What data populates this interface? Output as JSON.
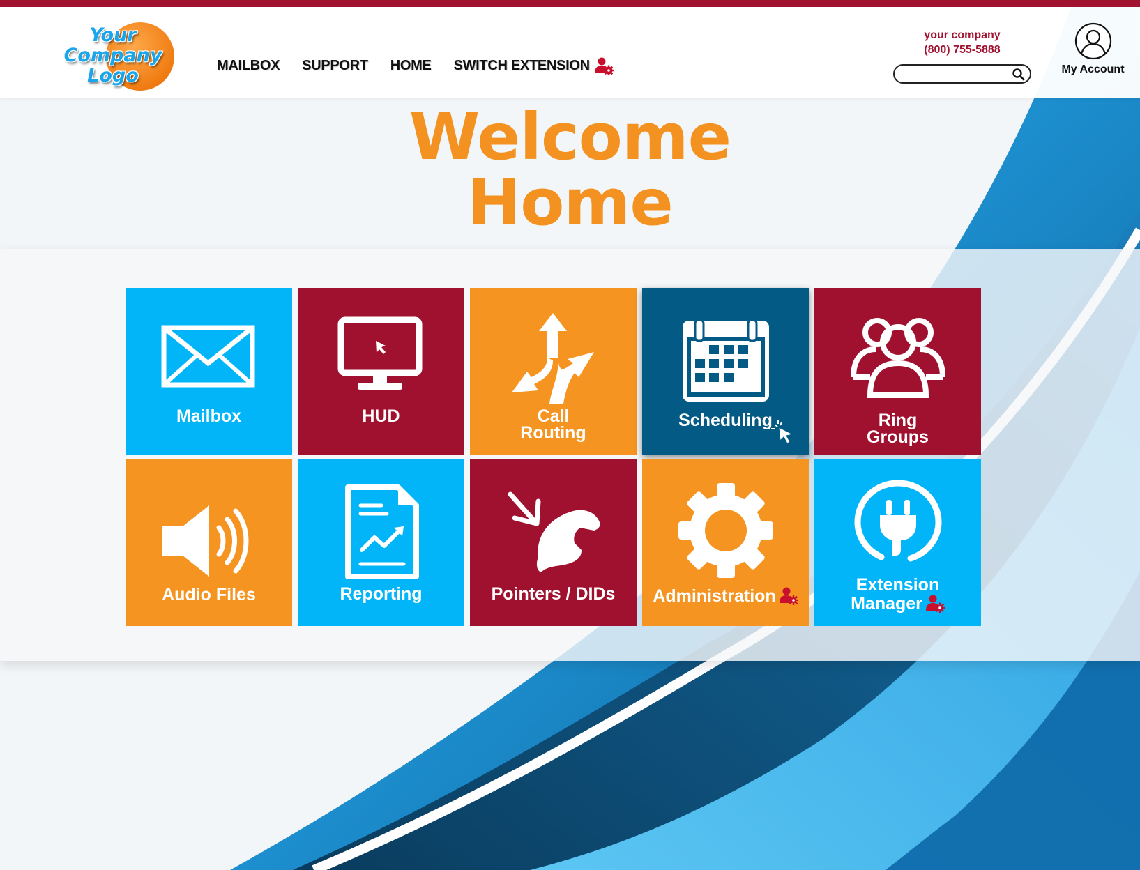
{
  "header": {
    "logo_text": "Your Company Logo",
    "nav": [
      {
        "label": "MAILBOX"
      },
      {
        "label": "SUPPORT"
      },
      {
        "label": "HOME"
      },
      {
        "label": "SWITCH EXTENSION"
      }
    ],
    "company_name": "your company",
    "company_phone": "(800) 755-5888",
    "search": {
      "value": "",
      "placeholder": ""
    },
    "account_label": "My Account"
  },
  "welcome": {
    "line1": "Welcome",
    "line2": "Home"
  },
  "tiles": [
    {
      "label": "Mailbox"
    },
    {
      "label": "HUD"
    },
    {
      "label1": "Call",
      "label2": "Routing"
    },
    {
      "label": "Scheduling"
    },
    {
      "label1": "Ring",
      "label2": "Groups"
    },
    {
      "label": "Audio Files"
    },
    {
      "label": "Reporting"
    },
    {
      "label": "Pointers / DIDs"
    },
    {
      "label": "Administration"
    },
    {
      "label1": "Extension",
      "label2": "Manager"
    }
  ],
  "colors": {
    "brand_red": "#a0112f",
    "brand_orange": "#f59420",
    "brand_blue": "#02b5f8",
    "brand_navy": "#035a85"
  },
  "icons": [
    "envelope-icon",
    "monitor-icon",
    "split-arrows-icon",
    "calendar-icon",
    "users-icon",
    "speaker-icon",
    "report-icon",
    "phone-pointer-icon",
    "gear-icon",
    "plug-icon",
    "user-gear-icon",
    "search-icon",
    "user-icon",
    "cursor-icon"
  ]
}
